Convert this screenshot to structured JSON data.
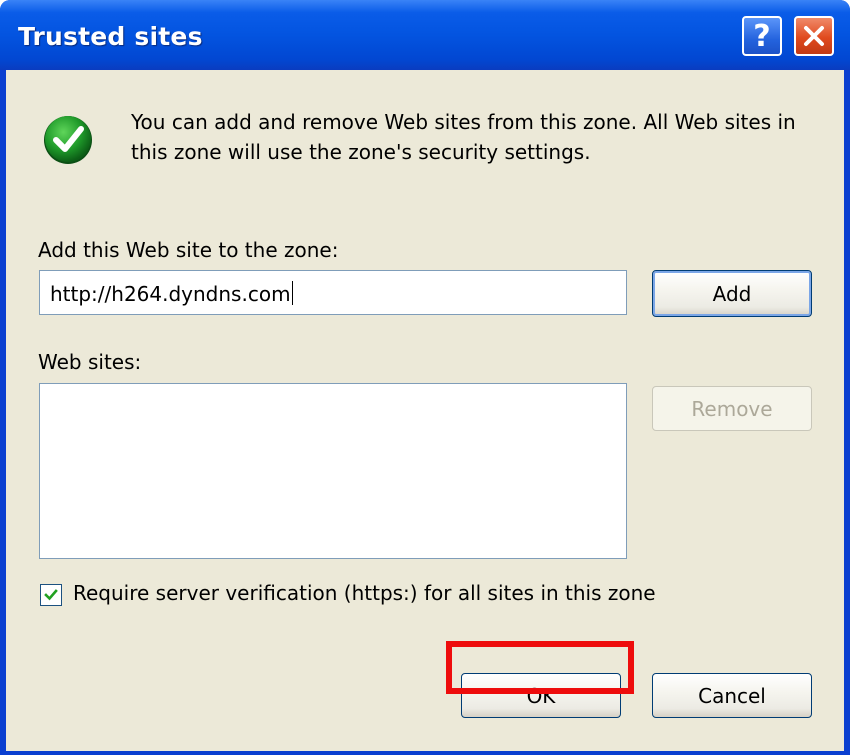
{
  "window": {
    "title": "Trusted sites",
    "help_button": "?",
    "close_icon": "close-icon"
  },
  "info": {
    "icon": "green-check-icon",
    "text": "You can add and remove Web sites from this zone. All Web sites in this zone will use the zone's security settings."
  },
  "add_site": {
    "label": "Add this Web site to the zone:",
    "value": "http://h264.dyndns.com",
    "button_label": "Add"
  },
  "web_sites": {
    "label": "Web sites:",
    "items": [],
    "remove_label": "Remove"
  },
  "require_verification": {
    "checked": true,
    "label": "Require server verification (https:) for all sites in this zone"
  },
  "footer": {
    "ok_label": "OK",
    "cancel_label": "Cancel"
  },
  "colors": {
    "title_bar": "#0354e0",
    "dialog_bg": "#ece9d8",
    "highlight": "#ee0c0c"
  }
}
